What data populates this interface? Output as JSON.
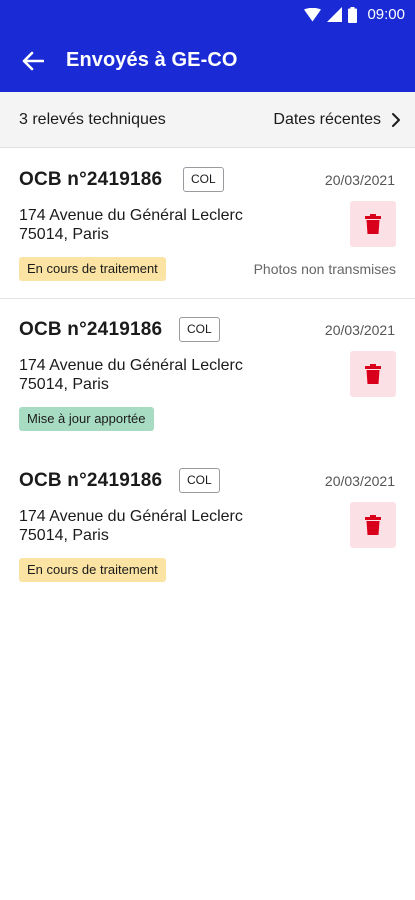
{
  "statusbar": {
    "time": "09:00"
  },
  "appbar": {
    "title": "Envoyés à GE-CO"
  },
  "sortbar": {
    "count_label": "3 relevés techniques",
    "sort_label": "Dates récentes"
  },
  "colors": {
    "primary": "#1a2bd6",
    "delete_bg": "#fbe1e6",
    "delete_icon": "#d9001b",
    "status_pending": "#fbe3a3",
    "status_updated": "#a8dcc2"
  },
  "cards": [
    {
      "ref": "OCB n°2419186",
      "tag": "COL",
      "date": "20/03/2021",
      "address_line1": "174 Avenue du Général Leclerc",
      "address_line2": "75014, Paris",
      "status": "En cours de traitement",
      "note": "Photos non transmises"
    },
    {
      "ref": "OCB n°2419186",
      "tag": "COL",
      "date": "20/03/2021",
      "address_line1": "174 Avenue du Général Leclerc",
      "address_line2": "75014, Paris",
      "status": "Mise à jour apportée",
      "note": ""
    },
    {
      "ref": "OCB n°2419186",
      "tag": "COL",
      "date": "20/03/2021",
      "address_line1": "174 Avenue du Général Leclerc",
      "address_line2": "75014, Paris",
      "status": "En cours de traitement",
      "note": ""
    }
  ]
}
